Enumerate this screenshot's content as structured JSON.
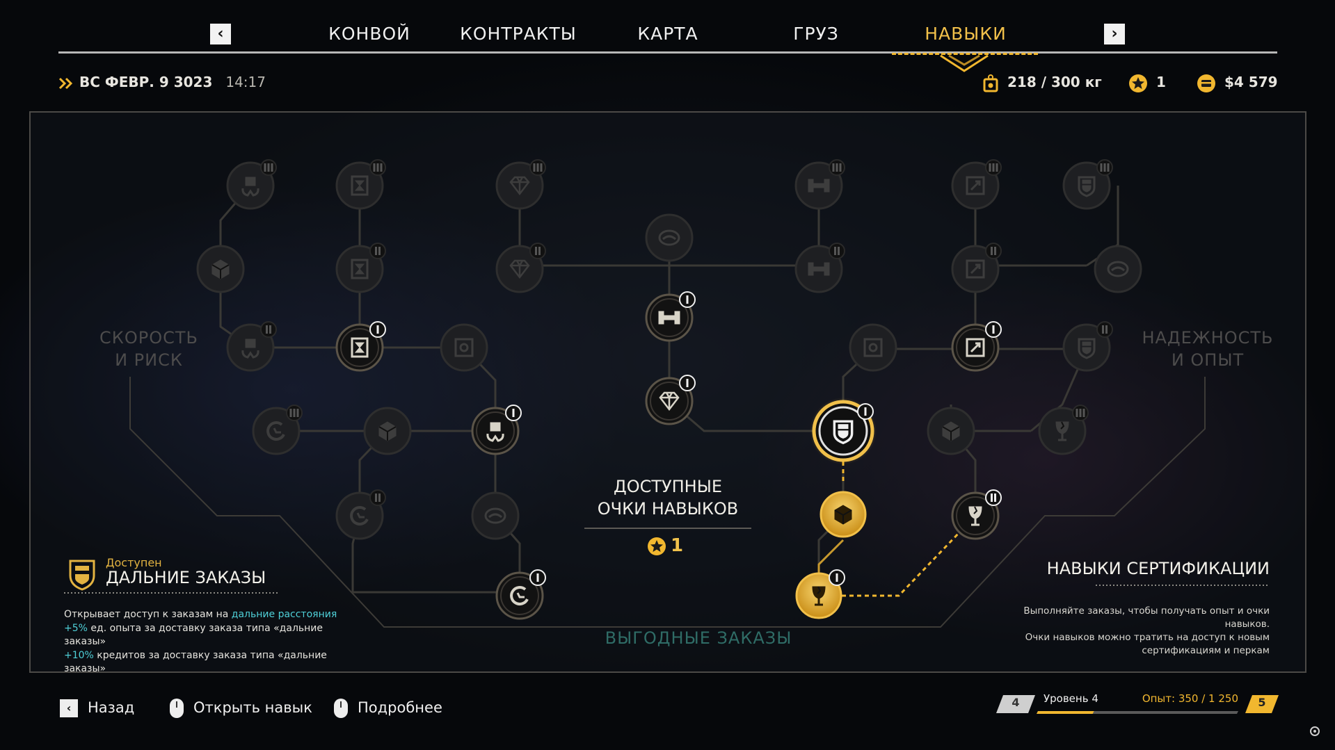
{
  "nav": {
    "prev_label": "‹",
    "next_label": "›",
    "tabs": [
      {
        "label": "КОНВОЙ"
      },
      {
        "label": "КОНТРАКТЫ"
      },
      {
        "label": "КАРТА"
      },
      {
        "label": "ГРУЗ"
      },
      {
        "label": "НАВЫКИ"
      }
    ],
    "active_tab": "НАВЫКИ"
  },
  "info": {
    "date": "ВС ФЕВР. 9 3023",
    "time": "14:17",
    "cargo": "218 / 300 кг",
    "skill_points": "1",
    "credits": "$4 579"
  },
  "tree": {
    "left_branch": "СКОРОСТЬ\nИ РИСК",
    "right_branch": "НАДЕЖНОСТЬ\nИ ОПЫТ",
    "bottom_branch": "ВЫГОДНЫЕ ЗАКАЗЫ",
    "available_title": "ДОСТУПНЫЕ\nОЧКИ НАВЫКОВ",
    "available_points": "1",
    "node_icons": [
      "hands-box-icon",
      "hazard-crate-icon",
      "diamond-icon",
      "dumbbell-icon",
      "expand-icon",
      "shield-badge-icon",
      "box-icon",
      "helmet-icon",
      "vault-icon",
      "clock-speed-icon",
      "fragile-icon"
    ]
  },
  "selected": {
    "status": "Доступен",
    "name": "ДАЛЬНИЕ ЗАКАЗЫ",
    "desc_1_prefix": "Открывает доступ к заказам на ",
    "desc_1_link": "дальние расстояния",
    "desc_2_pct": "+5%",
    "desc_2_text": " ед. опыта за доставку заказа типа «дальние заказы»",
    "desc_3_pct": "+10%",
    "desc_3_text": " кредитов за доставку заказа типа «дальние заказы»"
  },
  "certification": {
    "title": "НАВЫКИ СЕРТИФИКАЦИИ",
    "desc": "Выполняйте заказы, чтобы получать опыт и очки\nнавыков.\nОчки навыков можно тратить на доступ к новым\nсертификациям и перкам"
  },
  "footer": {
    "back": "Назад",
    "open_skill": "Открыть навык",
    "details": "Подробнее"
  },
  "level": {
    "current": "4",
    "label": "Уровень 4",
    "xp": "Опыт: 350 / 1 250",
    "next": "5",
    "progress": 0.28
  },
  "colors": {
    "gold": "#f1c04a",
    "cyan": "#4fd0d8",
    "dim": "#4d4c4c"
  }
}
